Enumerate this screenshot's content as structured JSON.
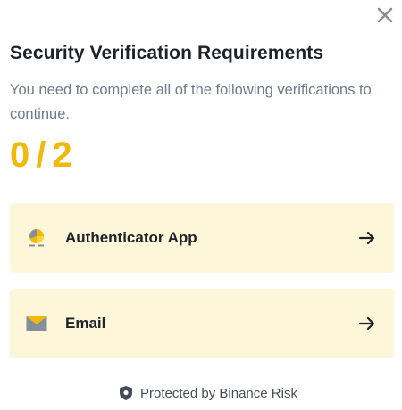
{
  "dialog": {
    "title": "Security Verification Requirements",
    "subtitle": "You need to complete all of the following verifications to continue.",
    "close_icon": "close-icon"
  },
  "progress": {
    "completed": "0",
    "separator": "/",
    "total": "2"
  },
  "methods": [
    {
      "label": "Authenticator App",
      "icon": "authenticator-app-icon",
      "action_icon": "arrow-right-icon"
    },
    {
      "label": "Email",
      "icon": "envelope-icon",
      "action_icon": "arrow-right-icon"
    }
  ],
  "footer": {
    "text": "Protected by Binance Risk",
    "icon": "shield-icon"
  },
  "colors": {
    "accent": "#f0b90b",
    "card_background": "#fef6d8",
    "title_text": "#1e2329",
    "secondary_text": "#707a8a",
    "icon_gray": "#848e9c"
  }
}
